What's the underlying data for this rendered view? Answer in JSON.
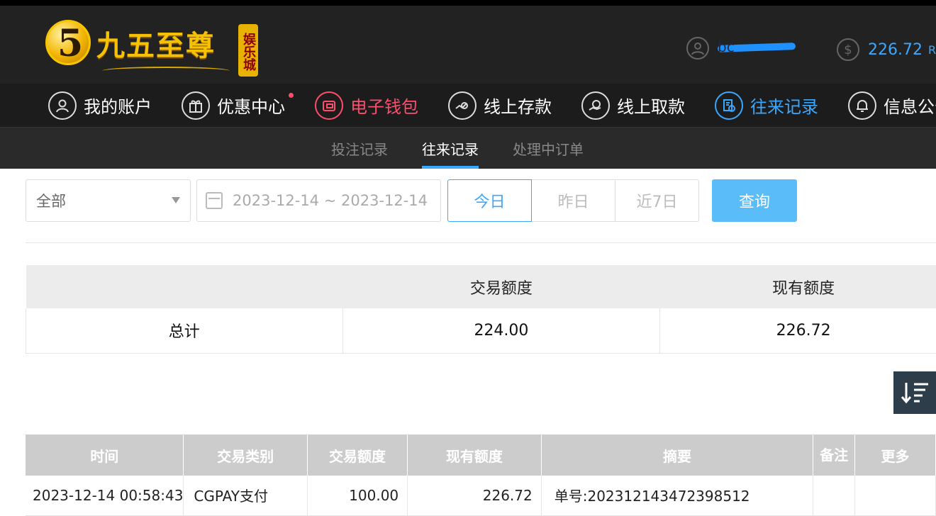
{
  "header": {
    "logo_text": "九五至尊",
    "logo_seal": "娱乐城",
    "logo_badge": "5",
    "username": "bc",
    "balance": "226.72",
    "balance_unit": "R"
  },
  "nav": {
    "items": [
      {
        "label": "我的账户",
        "icon": "user-icon"
      },
      {
        "label": "优惠中心",
        "icon": "gift-icon"
      },
      {
        "label": "电子钱包",
        "icon": "wallet-icon"
      },
      {
        "label": "线上存款",
        "icon": "deposit-icon"
      },
      {
        "label": "线上取款",
        "icon": "withdraw-icon"
      },
      {
        "label": "往来记录",
        "icon": "records-icon"
      },
      {
        "label": "信息公告",
        "icon": "bell-icon"
      }
    ]
  },
  "subnav": {
    "tabs": [
      "投注记录",
      "往来记录",
      "处理中订单"
    ],
    "active": "往来记录"
  },
  "filters": {
    "type_selected": "全部",
    "date_range": "2023-12-14 ~ 2023-12-14",
    "quick": [
      "今日",
      "昨日",
      "近7日"
    ],
    "query_label": "查询"
  },
  "summary": {
    "headers": [
      "",
      "交易额度",
      "现有额度"
    ],
    "row": [
      "总计",
      "224.00",
      "226.72"
    ]
  },
  "records": {
    "headers": [
      "时间",
      "交易类别",
      "交易额度",
      "现有额度",
      "摘要",
      "备注",
      "更多"
    ],
    "rows": [
      [
        "2023-12-14 00:58:43",
        "CGPAY支付",
        "100.00",
        "226.72",
        "单号:202312143472398512",
        "",
        ""
      ]
    ]
  },
  "colors": {
    "accent": "#3aa8ff",
    "wallet_active": "#ff4d6d",
    "query_button": "#5bbcfa",
    "header_bg": "#222222"
  }
}
